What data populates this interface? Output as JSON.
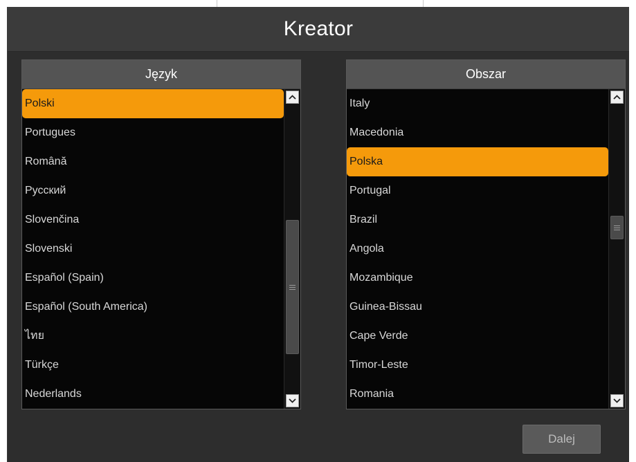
{
  "dialog": {
    "title": "Kreator"
  },
  "language_panel": {
    "header": "Język",
    "items": [
      {
        "label": "Polski",
        "selected": true
      },
      {
        "label": "Portugues",
        "selected": false
      },
      {
        "label": "Română",
        "selected": false
      },
      {
        "label": "Русский",
        "selected": false
      },
      {
        "label": "Slovenčina",
        "selected": false
      },
      {
        "label": "Slovenski",
        "selected": false
      },
      {
        "label": "Español (Spain)",
        "selected": false
      },
      {
        "label": "Español (South America)",
        "selected": false
      },
      {
        "label": "ไทย",
        "selected": false
      },
      {
        "label": "Türkçe",
        "selected": false
      },
      {
        "label": "Nederlands",
        "selected": false
      }
    ],
    "scroll_position": 0.62
  },
  "region_panel": {
    "header": "Obszar",
    "items": [
      {
        "label": "Italy",
        "selected": false
      },
      {
        "label": "Macedonia",
        "selected": false
      },
      {
        "label": "Polska",
        "selected": true
      },
      {
        "label": "Portugal",
        "selected": false
      },
      {
        "label": "Brazil",
        "selected": false
      },
      {
        "label": "Angola",
        "selected": false
      },
      {
        "label": "Mozambique",
        "selected": false
      },
      {
        "label": "Guinea-Bissau",
        "selected": false
      },
      {
        "label": "Cape Verde",
        "selected": false
      },
      {
        "label": "Timor-Leste",
        "selected": false
      },
      {
        "label": "Romania",
        "selected": false
      }
    ],
    "scroll_position": 0.43
  },
  "footer": {
    "next_label": "Dalej"
  },
  "colors": {
    "accent": "#f59a0b",
    "background": "#2d2d2d",
    "title_bar": "#3b3b3b",
    "list_background": "#060606"
  },
  "icons": {
    "scroll_up": "chevron-up-icon",
    "scroll_down": "chevron-down-icon",
    "thumb_grip": "grip-icon"
  }
}
